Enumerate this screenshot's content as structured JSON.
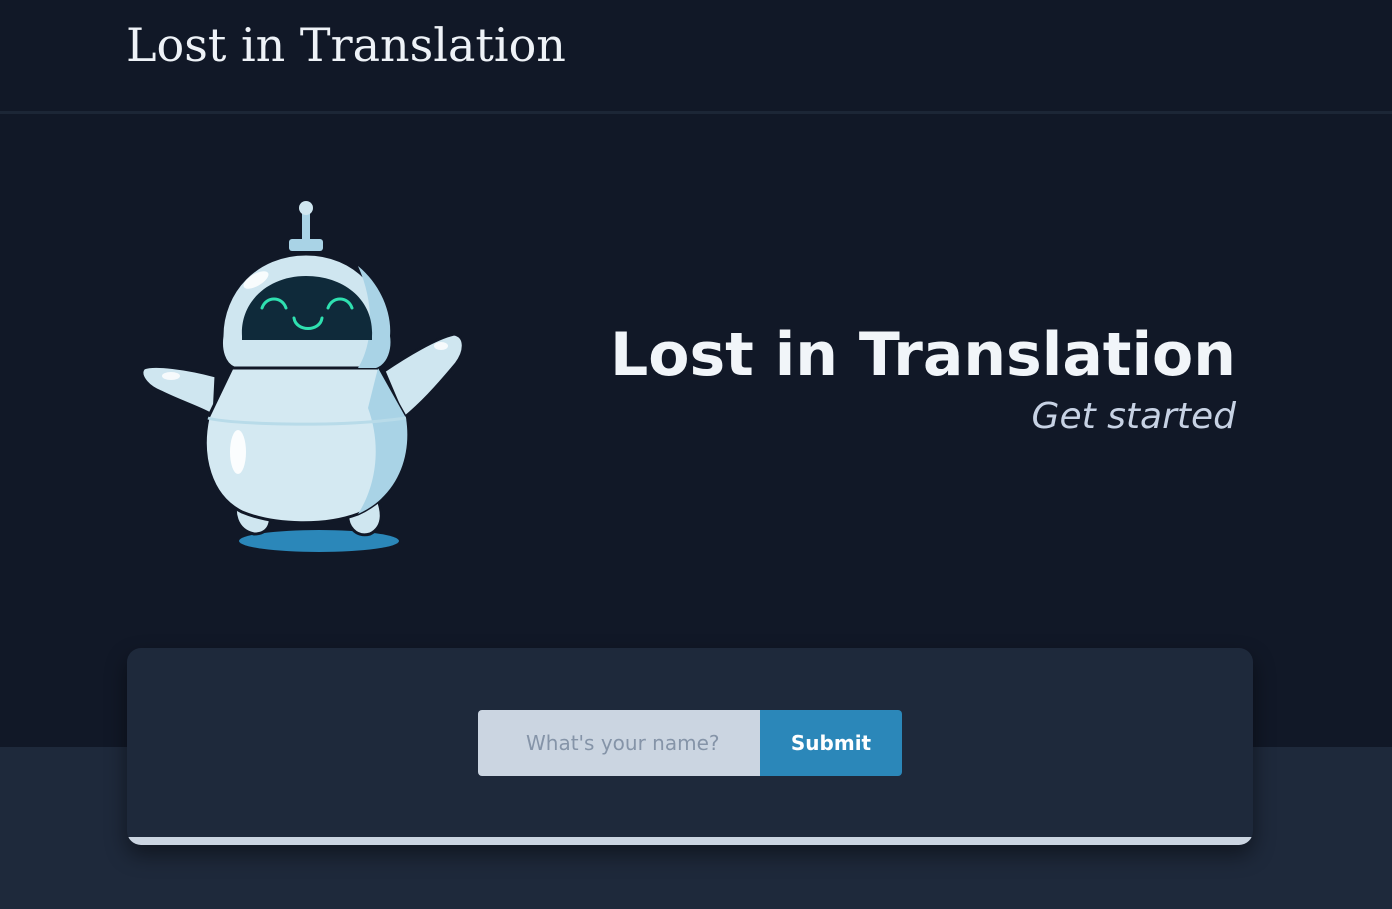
{
  "header": {
    "brand_title": "Lost in Translation"
  },
  "hero": {
    "title": "Lost in Translation",
    "subtitle": "Get started",
    "illustration": "robot-mascot"
  },
  "login_form": {
    "name_placeholder": "What's your name?",
    "name_value": "",
    "submit_label": "Submit"
  },
  "colors": {
    "background": "#111827",
    "surface": "#1e293b",
    "accent": "#2b87b9",
    "input": "#cbd5e1",
    "text": "#f1f5f9",
    "robot_body": "#cfe6f0",
    "robot_face": "#0f2a3a",
    "robot_smile": "#2fe0b0"
  }
}
